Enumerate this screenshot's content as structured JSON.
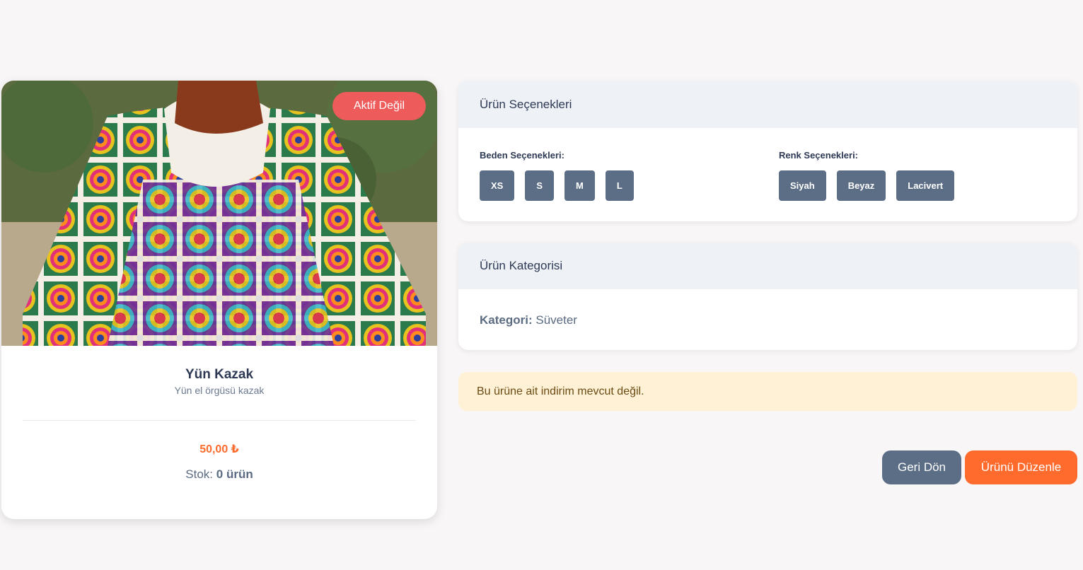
{
  "product": {
    "status_badge": "Aktif Değil",
    "name": "Yün Kazak",
    "description": "Yün el örgüsü kazak",
    "price": "50,00 ₺",
    "stock_label": "Stok:",
    "stock_value": "0 ürün"
  },
  "options_panel": {
    "title": "Ürün Seçenekleri",
    "sizes": {
      "label": "Beden Seçenekleri:",
      "items": [
        "XS",
        "S",
        "M",
        "L"
      ]
    },
    "colors": {
      "label": "Renk Seçenekleri:",
      "items": [
        "Siyah",
        "Beyaz",
        "Lacivert"
      ]
    }
  },
  "category_panel": {
    "title": "Ürün Kategorisi",
    "label": "Kategori:",
    "value": "Süveter"
  },
  "discount": {
    "message": "Bu ürüne ait indirim mevcut değil."
  },
  "actions": {
    "back_label": "Geri Dön",
    "edit_label": "Ürünü Düzenle"
  },
  "colors": {
    "accent": "#ff6b2c",
    "badge": "#ee5b5b",
    "chip": "#5c6e86",
    "alert_bg": "#fff1d6"
  }
}
